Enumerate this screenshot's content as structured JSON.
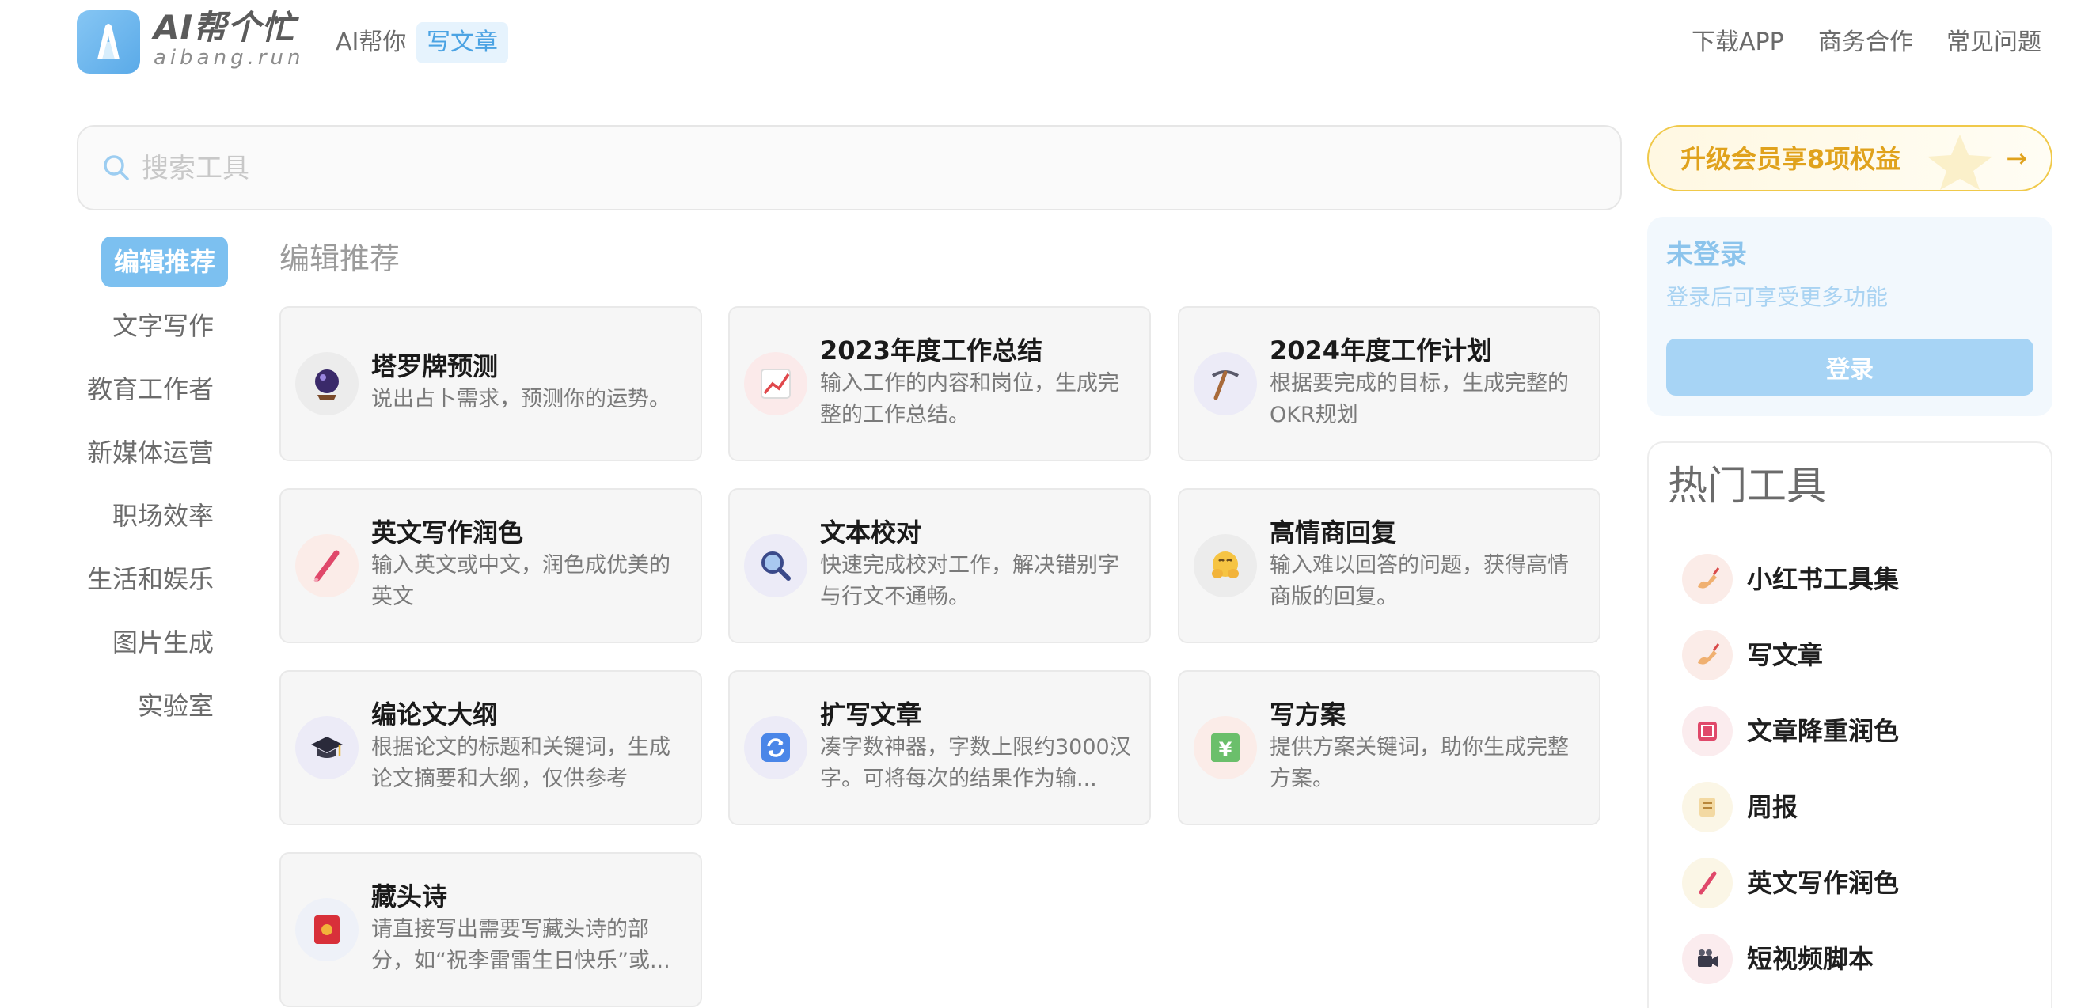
{
  "header": {
    "brand_title": "AI帮个忙",
    "brand_sub": "aibang.run",
    "nav_ai": "AI帮你",
    "nav_active": "写文章",
    "download": "下载APP",
    "business": "商务合作",
    "faq": "常见问题"
  },
  "search": {
    "placeholder": "搜索工具"
  },
  "upgrade": {
    "label": "升级会员享8项权益",
    "arrow": "→"
  },
  "menu": {
    "active": "编辑推荐",
    "items": [
      "文字写作",
      "教育工作者",
      "新媒体运营",
      "职场效率",
      "生活和娱乐",
      "图片生成",
      "实验室"
    ]
  },
  "section": {
    "title": "编辑推荐"
  },
  "cards": [
    {
      "title": "塔罗牌预测",
      "desc": "说出占卜需求，预测你的运势。",
      "icon": "crystal-ball-icon"
    },
    {
      "title": "2023年度工作总结",
      "desc": "输入工作的内容和岗位，生成完整的工作总结。",
      "icon": "chart-increasing-icon"
    },
    {
      "title": "2024年度工作计划",
      "desc": "根据要完成的目标，生成完整的OKR规划",
      "icon": "pickaxe-icon"
    },
    {
      "title": "英文写作润色",
      "desc": "输入英文或中文，润色成优美的英文",
      "icon": "crayon-icon"
    },
    {
      "title": "文本校对",
      "desc": "快速完成校对工作，解决错别字与行文不通畅。",
      "icon": "magnifier-icon"
    },
    {
      "title": "高情商回复",
      "desc": "输入难以回答的问题，获得高情商版的回复。",
      "icon": "smiling-face-hands-icon"
    },
    {
      "title": "编论文大纲",
      "desc": "根据论文的标题和关键词，生成论文摘要和大纲，仅供参考",
      "icon": "graduation-cap-icon"
    },
    {
      "title": "扩写文章",
      "desc": "凑字数神器，字数上限约3000汉字。可将每次的结果作为输...",
      "icon": "refresh-arrows-icon"
    },
    {
      "title": "写方案",
      "desc": "提供方案关键词，助你生成完整方案。",
      "icon": "yen-chart-icon"
    },
    {
      "title": "藏头诗",
      "desc": "请直接写出需要写藏头诗的部分，如“祝李雷雷生日快乐”或...",
      "icon": "red-envelope-icon"
    }
  ],
  "login": {
    "title": "未登录",
    "subtitle": "登录后可享受更多功能",
    "button": "登录"
  },
  "hot": {
    "title": "热门工具",
    "items": [
      {
        "label": "小红书工具集",
        "icon": "writing-hand-icon"
      },
      {
        "label": "写文章",
        "icon": "writing-hand-icon"
      },
      {
        "label": "文章降重润色",
        "icon": "red-square-icon"
      },
      {
        "label": "周报",
        "icon": "scroll-icon"
      },
      {
        "label": "英文写作润色",
        "icon": "crayon-icon"
      },
      {
        "label": "短视频脚本",
        "icon": "movie-camera-icon"
      }
    ]
  },
  "colors": {
    "accent": "#4ba3e3",
    "menu_active_bg": "#7cc0f0",
    "gold": "#e0a21c"
  }
}
